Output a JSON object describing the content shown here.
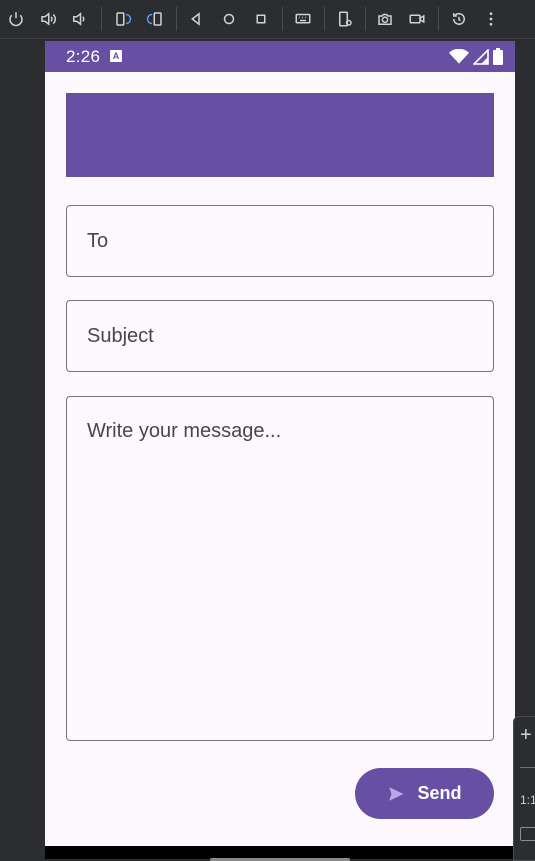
{
  "toolbar": {
    "buttons": [
      {
        "name": "power-icon"
      },
      {
        "name": "volume-up-icon"
      },
      {
        "name": "volume-down-icon"
      },
      {
        "name": "rotate-left-icon"
      },
      {
        "name": "rotate-right-icon"
      },
      {
        "name": "back-icon"
      },
      {
        "name": "home-icon"
      },
      {
        "name": "overview-icon"
      },
      {
        "name": "keyboard-icon"
      },
      {
        "name": "device-settings-icon"
      },
      {
        "name": "camera-icon"
      },
      {
        "name": "screenrecord-icon"
      },
      {
        "name": "reset-icon"
      },
      {
        "name": "more-icon"
      }
    ]
  },
  "status_bar": {
    "time": "2:26",
    "badge": "A",
    "accent": "#6750a4"
  },
  "form": {
    "to_placeholder": "To",
    "subject_placeholder": "Subject",
    "message_placeholder": "Write your message..."
  },
  "send_button": {
    "label": "Send",
    "icon": "send-icon"
  },
  "side_panel": {
    "zoom_label": "1:1"
  }
}
